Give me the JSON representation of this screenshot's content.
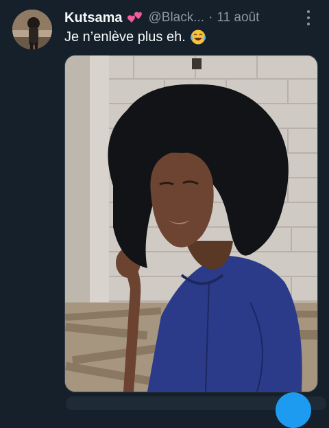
{
  "tweet": {
    "author_name": "Kutsama",
    "author_emoji": "two-hearts-emoji",
    "handle": "@Black...",
    "separator": "·",
    "date": "11 août",
    "text": "Je n’enlève plus eh.",
    "text_emoji": "face-with-tears-of-joy-emoji"
  },
  "colors": {
    "background": "#15202b",
    "primary_text": "#f7f9f9",
    "secondary_text": "#8b98a5",
    "accent": "#1d9bf0"
  },
  "icons": {
    "more": "more-dots-icon"
  }
}
